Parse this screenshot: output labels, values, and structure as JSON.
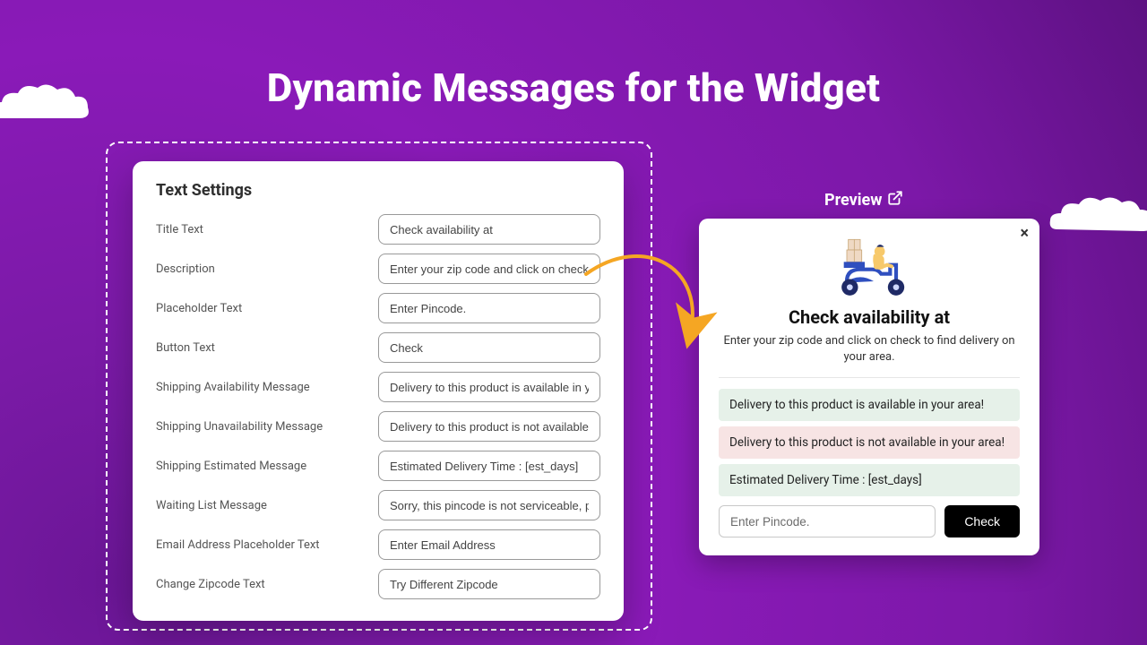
{
  "hero": {
    "title": "Dynamic Messages for the Widget"
  },
  "settings": {
    "heading": "Text Settings",
    "fields": [
      {
        "label": "Title Text",
        "value": "Check availability at"
      },
      {
        "label": "Description",
        "value": "Enter your zip code and click on check to find delivery on your area."
      },
      {
        "label": "Placeholder Text",
        "value": "Enter Pincode."
      },
      {
        "label": "Button Text",
        "value": "Check"
      },
      {
        "label": "Shipping Availability Message",
        "value": "Delivery to this product is available in your area!"
      },
      {
        "label": "Shipping Unavailability Message",
        "value": "Delivery to this product is not available in your area!"
      },
      {
        "label": "Shipping Estimated Message",
        "value": "Estimated Delivery Time : [est_days]"
      },
      {
        "label": "Waiting List Message",
        "value": "Sorry, this pincode is not serviceable, please enter your email."
      },
      {
        "label": "Email Address Placeholder Text",
        "value": "Enter Email Address"
      },
      {
        "label": "Change Zipcode Text",
        "value": "Try Different Zipcode"
      }
    ]
  },
  "preview": {
    "label": "Preview",
    "title": "Check availability at",
    "description": "Enter your zip code and click on check to find delivery on your area.",
    "messages": {
      "available": "Delivery to this product is available in your area!",
      "unavailable": "Delivery to this product is not available in your area!",
      "estimated": "Estimated Delivery Time : [est_days]"
    },
    "placeholder": "Enter Pincode.",
    "button": "Check"
  },
  "colors": {
    "accent_orange": "#f5a623",
    "msg_success_bg": "#e6f1e9",
    "msg_error_bg": "#f7e4e4"
  }
}
